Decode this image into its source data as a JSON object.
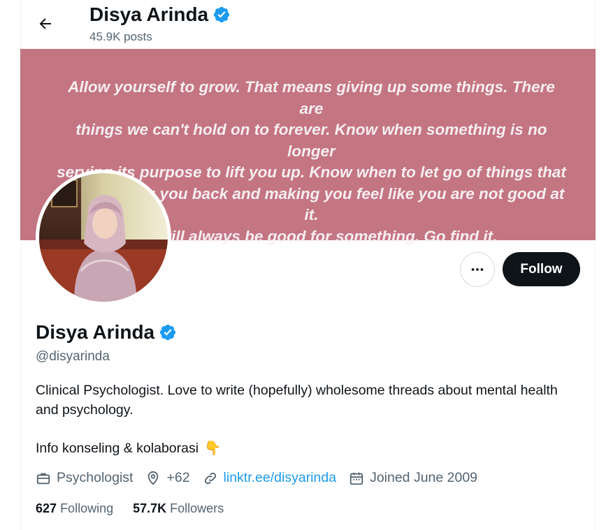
{
  "header": {
    "name": "Disya Arinda",
    "posts": "45.9K posts"
  },
  "banner": {
    "quote": "Allow yourself to grow. That means giving up some things. There are\nthings we can't hold on to forever. Know when something is no longer\nserving its purpose to lift you up. Know when to let go of things that\nkeep holding you back and making you feel like you are not good at it.\nYou will always be good for something. Go find it."
  },
  "actions": {
    "follow_label": "Follow"
  },
  "profile": {
    "name": "Disya Arinda",
    "handle": "@disyarinda",
    "bio": "Clinical Psychologist. Love to write (hopefully) wholesome threads about mental health and psychology.",
    "bio_line2": "Info konseling & kolaborasi",
    "bio_emoji": "👇"
  },
  "meta": {
    "profession": "Psychologist",
    "location": "+62",
    "link": "linktr.ee/disyarinda",
    "joined": "Joined June 2009"
  },
  "stats": {
    "following_count": "627",
    "following_label": "Following",
    "followers_count": "57.7K",
    "followers_label": "Followers"
  },
  "colors": {
    "banner": "#c47582",
    "verified": "#1d9bf0",
    "link": "#1d9bf0",
    "follow_bg": "#0f1419"
  },
  "icons": [
    "back-arrow-icon",
    "verified-badge-icon",
    "more-icon",
    "briefcase-icon",
    "location-pin-icon",
    "link-icon",
    "calendar-icon"
  ]
}
